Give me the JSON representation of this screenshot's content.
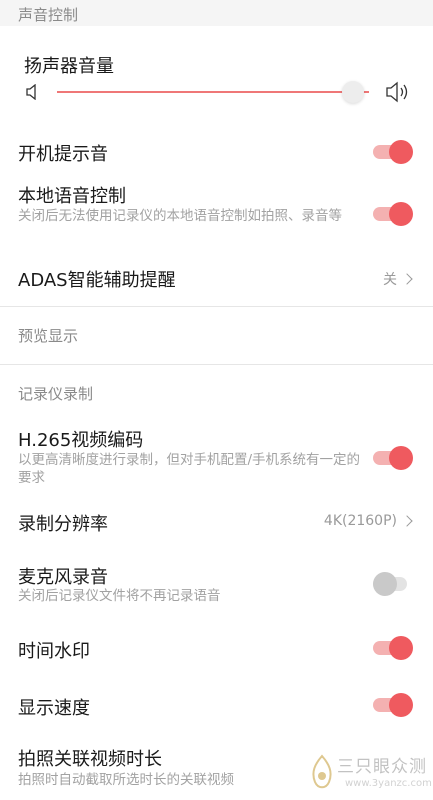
{
  "sections": {
    "sound": "声音控制",
    "preview": "预览显示",
    "recorder": "记录仪录制"
  },
  "speaker_volume": {
    "title": "扬声器音量",
    "level": 0.95,
    "accent": "#ef7777"
  },
  "rows": {
    "boot_sound": {
      "title": "开机提示音",
      "enabled": true
    },
    "local_voice": {
      "title": "本地语音控制",
      "desc": "关闭后无法使用记录仪的本地语音控制如拍照、录音等",
      "enabled": true
    },
    "adas": {
      "title": "ADAS智能辅助提醒",
      "value": "关"
    },
    "h265": {
      "title": "H.265视频编码",
      "desc": "以更高清晰度进行录制，但对手机配置/手机系统有一定的要求",
      "enabled": true
    },
    "resolution": {
      "title": "录制分辨率",
      "value": "4K(2160P)"
    },
    "mic": {
      "title": "麦克风录音",
      "desc": "关闭后记录仪文件将不再记录语音",
      "enabled": false
    },
    "time_watermark": {
      "title": "时间水印",
      "enabled": true
    },
    "show_speed": {
      "title": "显示速度",
      "enabled": true
    },
    "photo_video": {
      "title": "拍照关联视频时长",
      "desc": "拍照时自动截取所选时长的关联视频"
    }
  },
  "watermark": {
    "brand": "三只眼众测",
    "url": "www.3yanzc.com"
  },
  "colors": {
    "accent": "#ef5a5f",
    "muted": "#a2a2a2"
  }
}
